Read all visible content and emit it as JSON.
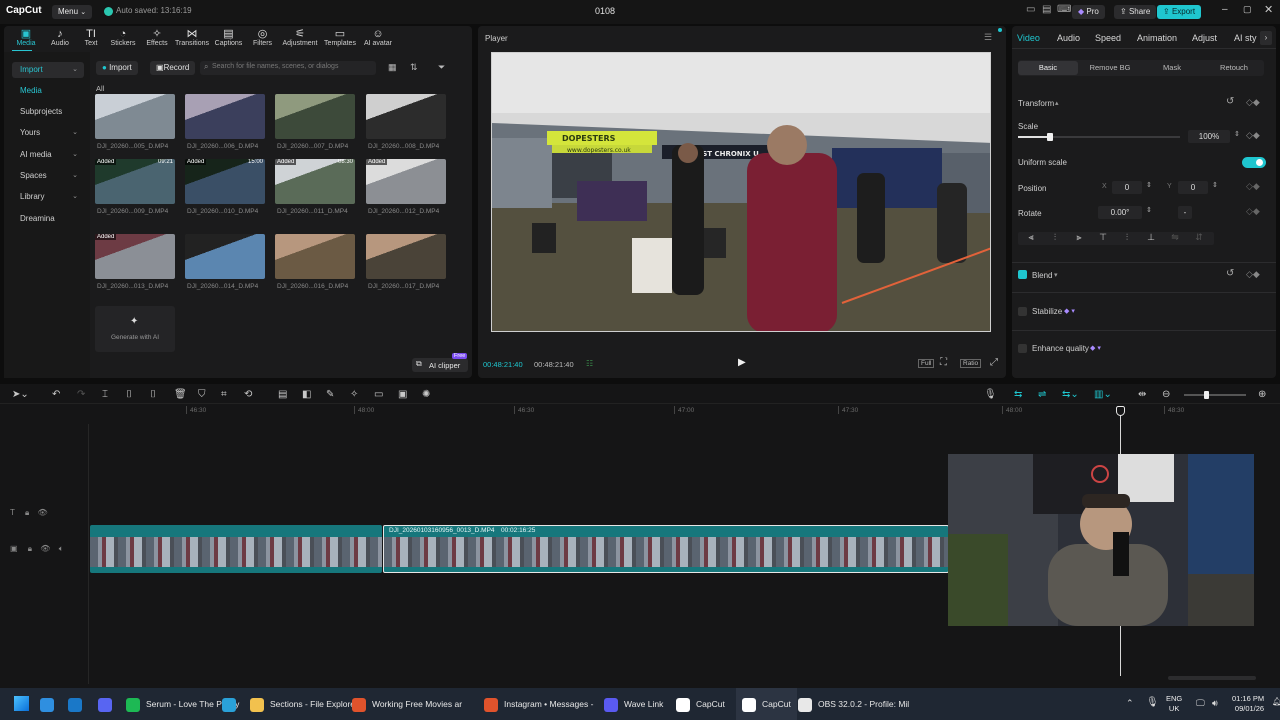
{
  "titlebar": {
    "app_name": "CapCut",
    "menu_label": "Menu",
    "autosave": "Auto saved: 13:16:19",
    "project_name": "0108",
    "pro_label": "Pro",
    "share_label": "Share",
    "export_label": "Export"
  },
  "toolbar": [
    {
      "label": "Media",
      "icon": "media-icon"
    },
    {
      "label": "Audio",
      "icon": "audio-icon"
    },
    {
      "label": "Text",
      "icon": "text-icon"
    },
    {
      "label": "Stickers",
      "icon": "stickers-icon"
    },
    {
      "label": "Effects",
      "icon": "effects-icon"
    },
    {
      "label": "Transitions",
      "icon": "transitions-icon"
    },
    {
      "label": "Captions",
      "icon": "captions-icon"
    },
    {
      "label": "Filters",
      "icon": "filters-icon"
    },
    {
      "label": "Adjustment",
      "icon": "adjustment-icon"
    },
    {
      "label": "Templates",
      "icon": "templates-icon"
    },
    {
      "label": "AI avatar",
      "icon": "ai-avatar-icon"
    }
  ],
  "sidebar": {
    "items": [
      {
        "label": "Import",
        "chevron": true
      },
      {
        "label": "Media",
        "chevron": false
      },
      {
        "label": "Subprojects",
        "chevron": false
      },
      {
        "label": "Yours",
        "chevron": true
      },
      {
        "label": "AI media",
        "chevron": true
      },
      {
        "label": "Spaces",
        "chevron": true
      },
      {
        "label": "Library",
        "chevron": true
      },
      {
        "label": "Dreamina",
        "chevron": false
      }
    ]
  },
  "media": {
    "import_label": "Import",
    "record_label": "Record",
    "search_placeholder": "Search for file names, scenes, or dialogs",
    "filter_all": "All",
    "files": [
      {
        "name": "DJI_20260...005_D.MP4",
        "added": "",
        "duration": ""
      },
      {
        "name": "DJI_20260...006_D.MP4",
        "added": "",
        "duration": ""
      },
      {
        "name": "DJI_20260...007_D.MP4",
        "added": "",
        "duration": ""
      },
      {
        "name": "DJI_20260...008_D.MP4",
        "added": "",
        "duration": ""
      },
      {
        "name": "DJI_20260...009_D.MP4",
        "added": "Added",
        "duration": "09:21"
      },
      {
        "name": "DJI_20260...010_D.MP4",
        "added": "Added",
        "duration": "15:00"
      },
      {
        "name": "DJI_20260...011_D.MP4",
        "added": "Added",
        "duration": "08:30"
      },
      {
        "name": "DJI_20260...012_D.MP4",
        "added": "Added",
        "duration": ""
      },
      {
        "name": "DJI_20260...013_D.MP4",
        "added": "Added",
        "duration": ""
      },
      {
        "name": "DJI_20260...014_D.MP4",
        "added": "",
        "duration": ""
      },
      {
        "name": "DJI_20260...016_D.MP4",
        "added": "",
        "duration": ""
      },
      {
        "name": "DJI_20260...017_D.MP4",
        "added": "",
        "duration": ""
      }
    ],
    "generate_label": "Generate with AI",
    "ai_clipper_label": "AI clipper",
    "ai_clipper_badge": "Free"
  },
  "player": {
    "title": "Player",
    "current_time": "00:48:21:40",
    "total_time": "00:48:21:40",
    "full_label": "Full",
    "ratio_label": "Ratio",
    "banner_text": "DOPESTERS",
    "banner_url": "www.dopesters.co.uk",
    "banner_text2": "EAST CHRONIX U"
  },
  "props": {
    "tabs": [
      "Video",
      "Audio",
      "Speed",
      "Animation",
      "Adjust",
      "AI sty"
    ],
    "subtabs": [
      "Basic",
      "Remove BG",
      "Mask",
      "Retouch"
    ],
    "transform_label": "Transform",
    "scale_label": "Scale",
    "scale_value": "100%",
    "scale_fraction": 0.2,
    "uniform_scale_label": "Uniform scale",
    "uniform_scale_on": true,
    "position_label": "Position",
    "pos_x_label": "X",
    "pos_x": "0",
    "pos_y_label": "Y",
    "pos_y": "0",
    "rotate_label": "Rotate",
    "rotate_value": "0.00°",
    "rotate_flip": "-",
    "blend_label": "Blend",
    "stabilize_label": "Stabilize",
    "enhance_label": "Enhance quality",
    "accent": "#1fc6cf"
  },
  "timeline": {
    "ruler": [
      "46:30",
      "48:00",
      "46:30",
      "47:00",
      "47:30",
      "48:00",
      "48:30"
    ],
    "clip_label": "DJI_20260103160956_0013_D.MP4",
    "clip_duration": "00:02:16:25"
  },
  "taskbar": {
    "items": [
      {
        "label": "",
        "color": "#2f8fe0"
      },
      {
        "label": "",
        "color": "#1a78c8"
      },
      {
        "label": "",
        "color": "#5865f2"
      },
      {
        "label": "Serum - Love The Pussy",
        "color": "#1db954"
      },
      {
        "label": "",
        "color": "#2aa1d8"
      },
      {
        "label": "Sections - File Explorer",
        "color": "#f2c14e"
      },
      {
        "label": "Working Free Movies ar",
        "color": "#e0532c"
      },
      {
        "label": "Instagram • Messages -",
        "color": "#e0532c"
      },
      {
        "label": "Wave Link",
        "color": "#5a5af0"
      },
      {
        "label": "CapCut",
        "color": "#ffffff"
      },
      {
        "label": "CapCut",
        "color": "#ffffff"
      },
      {
        "label": "OBS 32.0.2 - Profile: Mil",
        "color": "#e8e8e8"
      }
    ],
    "lang": "ENG",
    "region": "UK",
    "time": "01:16 PM",
    "date": "09/01/26"
  }
}
